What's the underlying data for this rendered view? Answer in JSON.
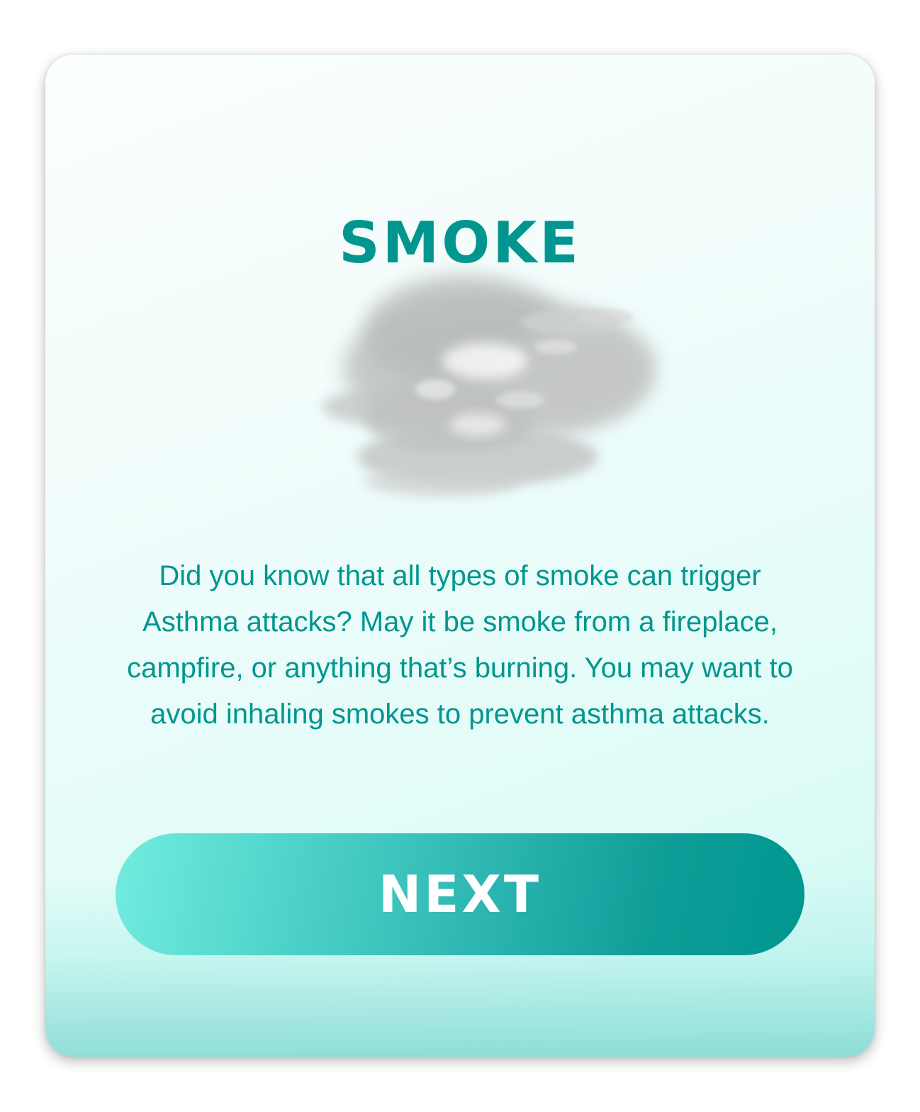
{
  "card": {
    "title": "SMOKE",
    "illustration_icon": "smoke-cloud-icon",
    "body": "Did you know that all types of smoke can trigger Asthma attacks? May it be smoke from a fireplace, campfire, or anything that’s burning. You may want to avoid inhaling smokes to prevent asthma attacks.",
    "next_label": "NEXT"
  },
  "colors": {
    "accent": "#00968f",
    "button_start": "#72ecdf",
    "button_end": "#00968f",
    "text": "#00968f"
  }
}
